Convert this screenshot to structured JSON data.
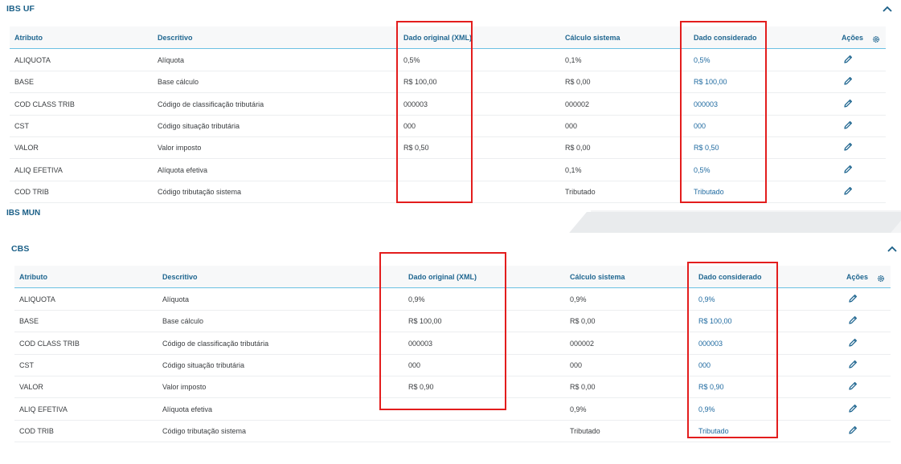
{
  "colors": {
    "title": "#1a5f87",
    "header_text": "#1f6690",
    "considered_value": "#1f6aa0",
    "header_border": "#6cc1e3",
    "highlight_box": "#e31d1d"
  },
  "icons": {
    "collapse": "chevron-up-icon",
    "settings": "gear-icon",
    "edit": "pencil-icon"
  },
  "ibs_uf": {
    "title": "IBS UF",
    "columns": {
      "atributo": "Atributo",
      "descritivo": "Descritivo",
      "original": "Dado original (XML)",
      "sistema": "Cálculo sistema",
      "considerado": "Dado considerado",
      "acoes": "Ações"
    },
    "rows": [
      {
        "atributo": "ALIQUOTA",
        "descritivo": "Alíquota",
        "original": "0,5%",
        "sistema": "0,1%",
        "considerado": "0,5%"
      },
      {
        "atributo": "BASE",
        "descritivo": "Base cálculo",
        "original": "R$ 100,00",
        "sistema": "R$ 0,00",
        "considerado": "R$ 100,00"
      },
      {
        "atributo": "COD CLASS TRIB",
        "descritivo": "Código de classificação tributária",
        "original": "000003",
        "sistema": "000002",
        "considerado": "000003"
      },
      {
        "atributo": "CST",
        "descritivo": "Código situação tributária",
        "original": "000",
        "sistema": "000",
        "considerado": "000"
      },
      {
        "atributo": "VALOR",
        "descritivo": "Valor imposto",
        "original": "R$ 0,50",
        "sistema": "R$ 0,00",
        "considerado": "R$ 0,50"
      },
      {
        "atributo": "ALIQ EFETIVA",
        "descritivo": "Alíquota efetiva",
        "original": "",
        "sistema": "0,1%",
        "considerado": "0,5%"
      },
      {
        "atributo": "COD TRIB",
        "descritivo": "Código tributação sistema",
        "original": "",
        "sistema": "Tributado",
        "considerado": "Tributado"
      }
    ]
  },
  "ibs_mun": {
    "title": "IBS MUN"
  },
  "cbs": {
    "title": "CBS",
    "columns": {
      "atributo": "Atributo",
      "descritivo": "Descritivo",
      "original": "Dado original (XML)",
      "sistema": "Cálculo sistema",
      "considerado": "Dado considerado",
      "acoes": "Ações"
    },
    "rows": [
      {
        "atributo": "ALIQUOTA",
        "descritivo": "Alíquota",
        "original": "0,9%",
        "sistema": "0,9%",
        "considerado": "0,9%"
      },
      {
        "atributo": "BASE",
        "descritivo": "Base cálculo",
        "original": "R$ 100,00",
        "sistema": "R$ 0,00",
        "considerado": "R$ 100,00"
      },
      {
        "atributo": "COD CLASS TRIB",
        "descritivo": "Código de classificação tributária",
        "original": "000003",
        "sistema": "000002",
        "considerado": "000003"
      },
      {
        "atributo": "CST",
        "descritivo": "Código situação tributária",
        "original": "000",
        "sistema": "000",
        "considerado": "000"
      },
      {
        "atributo": "VALOR",
        "descritivo": "Valor imposto",
        "original": "R$ 0,90",
        "sistema": "R$ 0,00",
        "considerado": "R$ 0,90"
      },
      {
        "atributo": "ALIQ EFETIVA",
        "descritivo": "Alíquota efetiva",
        "original": "",
        "sistema": "0,9%",
        "considerado": "0,9%"
      },
      {
        "atributo": "COD TRIB",
        "descritivo": "Código tributação sistema",
        "original": "",
        "sistema": "Tributado",
        "considerado": "Tributado"
      }
    ]
  }
}
